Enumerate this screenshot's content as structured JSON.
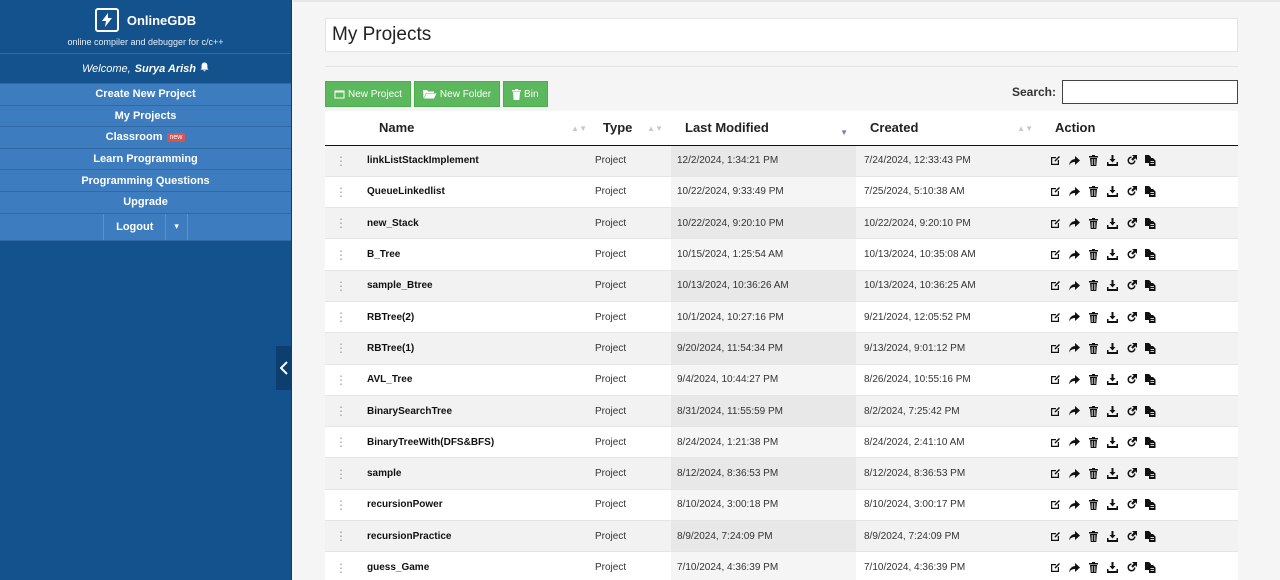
{
  "sidebar": {
    "brand_name": "OnlineGDB",
    "tagline": "online compiler and debugger for c/c++",
    "welcome_prefix": "Welcome,",
    "user_name": "Surya Arish",
    "menu": {
      "create": "Create New Project",
      "my_projects": "My Projects",
      "classroom": "Classroom",
      "classroom_badge": "new",
      "learn": "Learn Programming",
      "questions": "Programming Questions",
      "upgrade": "Upgrade",
      "logout": "Logout"
    }
  },
  "main": {
    "title": "My Projects",
    "toolbar": {
      "new_project": "New Project",
      "new_folder": "New Folder",
      "bin": "Bin",
      "search_label": "Search:",
      "search_value": ""
    },
    "columns": {
      "name": "Name",
      "type": "Type",
      "last_modified": "Last Modified",
      "created": "Created",
      "action": "Action"
    },
    "rows": [
      {
        "name": "linkListStackImplement",
        "type": "Project",
        "last_modified": "12/2/2024, 1:34:21 PM",
        "created": "7/24/2024, 12:33:43 PM"
      },
      {
        "name": "QueueLinkedlist",
        "type": "Project",
        "last_modified": "10/22/2024, 9:33:49 PM",
        "created": "7/25/2024, 5:10:38 AM"
      },
      {
        "name": "new_Stack",
        "type": "Project",
        "last_modified": "10/22/2024, 9:20:10 PM",
        "created": "10/22/2024, 9:20:10 PM"
      },
      {
        "name": "B_Tree",
        "type": "Project",
        "last_modified": "10/15/2024, 1:25:54 AM",
        "created": "10/13/2024, 10:35:08 AM"
      },
      {
        "name": "sample_Btree",
        "type": "Project",
        "last_modified": "10/13/2024, 10:36:26 AM",
        "created": "10/13/2024, 10:36:25 AM"
      },
      {
        "name": "RBTree(2)",
        "type": "Project",
        "last_modified": "10/1/2024, 10:27:16 PM",
        "created": "9/21/2024, 12:05:52 PM"
      },
      {
        "name": "RBTree(1)",
        "type": "Project",
        "last_modified": "9/20/2024, 11:54:34 PM",
        "created": "9/13/2024, 9:01:12 PM"
      },
      {
        "name": "AVL_Tree",
        "type": "Project",
        "last_modified": "9/4/2024, 10:44:27 PM",
        "created": "8/26/2024, 10:55:16 PM"
      },
      {
        "name": "BinarySearchTree",
        "type": "Project",
        "last_modified": "8/31/2024, 11:55:59 PM",
        "created": "8/2/2024, 7:25:42 PM"
      },
      {
        "name": "BinaryTreeWith(DFS&BFS)",
        "type": "Project",
        "last_modified": "8/24/2024, 1:21:38 PM",
        "created": "8/24/2024, 2:41:10 AM"
      },
      {
        "name": "sample",
        "type": "Project",
        "last_modified": "8/12/2024, 8:36:53 PM",
        "created": "8/12/2024, 8:36:53 PM"
      },
      {
        "name": "recursionPower",
        "type": "Project",
        "last_modified": "8/10/2024, 3:00:18 PM",
        "created": "8/10/2024, 3:00:17 PM"
      },
      {
        "name": "recursionPractice",
        "type": "Project",
        "last_modified": "8/9/2024, 7:24:09 PM",
        "created": "8/9/2024, 7:24:09 PM"
      },
      {
        "name": "guess_Game",
        "type": "Project",
        "last_modified": "7/10/2024, 4:36:39 PM",
        "created": "7/10/2024, 4:36:39 PM"
      }
    ],
    "row_actions": [
      "edit-icon",
      "share-icon",
      "trash-icon",
      "download-icon",
      "open-external-icon",
      "copy-icon"
    ],
    "colors": {
      "sidebar": "#13528c",
      "menu": "#3d7dbf",
      "green_button": "#5cb85c",
      "new_badge": "#d9534f"
    }
  }
}
